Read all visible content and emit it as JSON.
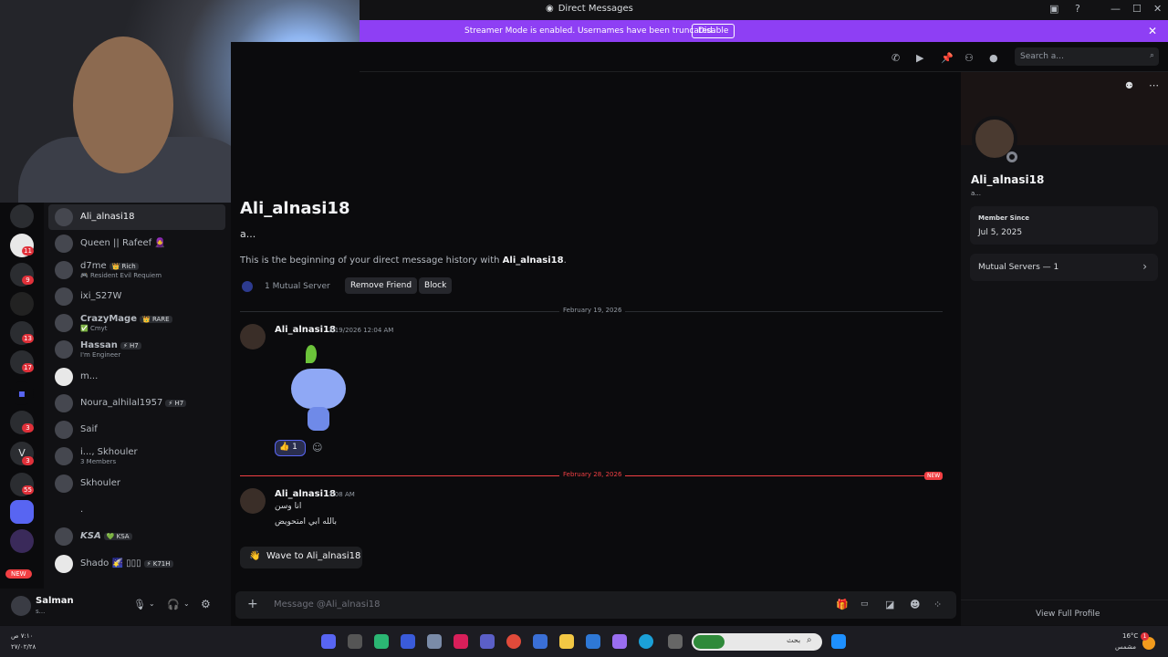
{
  "window": {
    "title": "Direct Messages"
  },
  "banner": {
    "text": "Streamer Mode is enabled. Usernames have been truncated.",
    "disable": "Disable"
  },
  "search": {
    "placeholder": "Search a..."
  },
  "server_badges": [
    "11",
    "9",
    "13",
    "17",
    "3",
    "3",
    "55"
  ],
  "server_v": "V",
  "new_badge": "NEW",
  "dms": [
    {
      "name": "Ali_alnasi18",
      "sub": "",
      "tag": ""
    },
    {
      "name": "Queen || Rafeef 🧕",
      "sub": "",
      "tag": ""
    },
    {
      "name": "d7me",
      "sub": "🎮 Resident Evil Requiem",
      "tag": "👑 Rich"
    },
    {
      "name": "ixi_S27W",
      "sub": "",
      "tag": ""
    },
    {
      "name": "CrazyMage",
      "sub": "✅ Cmyt",
      "tag": "👑 RARE"
    },
    {
      "name": "Hassan",
      "sub": "I'm Engineer",
      "tag": "⚡ H7"
    },
    {
      "name": "m...",
      "sub": "",
      "tag": ""
    },
    {
      "name": "Noura_alhilal1957",
      "sub": "",
      "tag": "⚡ H7"
    },
    {
      "name": "Saif",
      "sub": "",
      "tag": ""
    },
    {
      "name": "i..., Skhouler",
      "sub": "3 Members",
      "tag": ""
    },
    {
      "name": "Skhouler",
      "sub": "",
      "tag": ""
    },
    {
      "name": ".",
      "sub": "",
      "tag": ""
    },
    {
      "name": "KSA",
      "sub": "",
      "tag": "💚 KSA"
    },
    {
      "name": "Shado 🌠 ▯▯▯",
      "sub": "",
      "tag": "⚡ K71H"
    }
  ],
  "user": {
    "name": "Salman",
    "status": "s..."
  },
  "header": {
    "name": "Ali_alnasi18",
    "sub": "a...",
    "intro_prefix": "This is the beginning of your direct message history with ",
    "intro_name": "Ali_alnasi18",
    "intro_suffix": ".",
    "mutual": "1 Mutual Server",
    "remove": "Remove Friend",
    "block": "Block"
  },
  "messages": {
    "date1": "February 19, 2026",
    "author1": "Ali_alnasi18",
    "time1": "2/19/2026 12:04 AM",
    "reaction_count": "1",
    "date2": "February 28, 2026",
    "new": "NEW",
    "author2": "Ali_alnasi18",
    "time2": "7:08 AM",
    "line1": "انا وسن",
    "line2": "بالله ابي امتحويض",
    "wave": "Wave to Ali_alnasi18"
  },
  "composer": {
    "placeholder": "Message @Ali_alnasi18"
  },
  "profile": {
    "name": "Ali_alnasi18",
    "sub": "a...",
    "member_since_label": "Member Since",
    "member_since": "Jul 5, 2025",
    "mutual_servers": "Mutual Servers — 1",
    "view_full": "View Full Profile"
  },
  "taskbar": {
    "search": "بحث",
    "temp": "16°C",
    "weather": "مشمس",
    "time": "٧:١٠ ص",
    "date": "٢٧/٠٢/٢٨",
    "notif": "1"
  },
  "colors": {
    "accent": "#8e3ff4",
    "new_red": "#f23f43",
    "blurple": "#5865f2"
  }
}
